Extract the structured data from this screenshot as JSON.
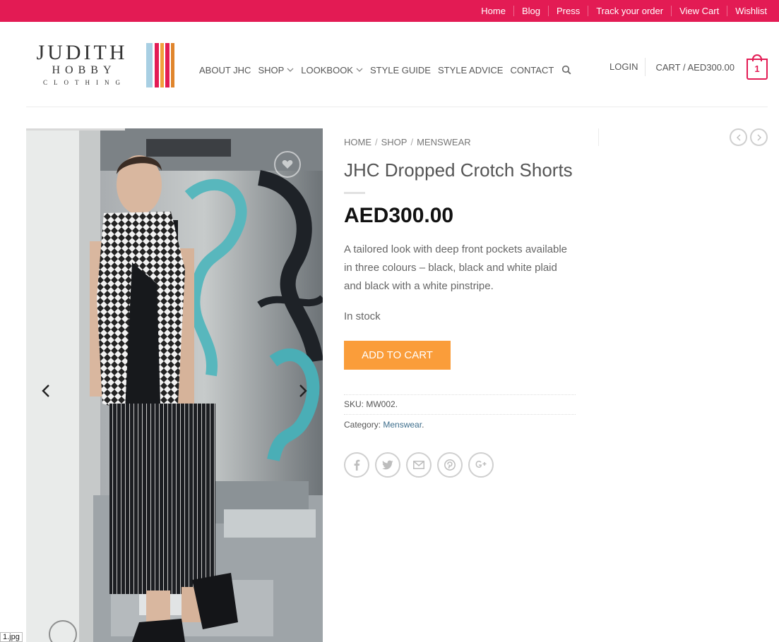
{
  "topbar": {
    "links": [
      "Home",
      "Blog",
      "Press",
      "Track your order",
      "View Cart",
      "Wishlist"
    ]
  },
  "logo": {
    "line1": "JUDITH",
    "line2": "HOBBY",
    "line3": "CLOTHING",
    "stripe_colors": [
      "#a8cfe3",
      "#e31b54",
      "#f2a03c",
      "#e0852c",
      "#e31b54"
    ]
  },
  "nav": {
    "items": [
      {
        "label": "ABOUT JHC",
        "has_caret": false
      },
      {
        "label": "SHOP",
        "has_caret": true
      },
      {
        "label": "LOOKBOOK",
        "has_caret": true
      },
      {
        "label": "STYLE GUIDE",
        "has_caret": false
      },
      {
        "label": "STYLE ADVICE",
        "has_caret": false
      },
      {
        "label": "CONTACT",
        "has_caret": false
      }
    ],
    "search_icon": "search-icon"
  },
  "account": {
    "login": "LOGIN",
    "cart_label": "CART / AED300.00",
    "cart_count": "1"
  },
  "breadcrumb": [
    "HOME",
    "SHOP",
    "MENSWEAR"
  ],
  "product": {
    "title": "JHC Dropped Crotch Shorts",
    "price": "AED300.00",
    "description": "A tailored look with deep front pockets available in three colours – black, black and white plaid and black with a white pinstripe.",
    "stock": "In stock",
    "add_to_cart": "ADD TO CART",
    "sku_label": "SKU:",
    "sku": "MW002.",
    "category_label": "Category:",
    "category": "Menswear",
    "category_suffix": "."
  },
  "share_icons": [
    "facebook-icon",
    "twitter-icon",
    "email-icon",
    "pinterest-icon",
    "google-plus-icon"
  ],
  "image_label": "1.jpg",
  "colors": {
    "brand_pink": "#e31b54",
    "cta_orange": "#fa9d3a",
    "link_blue": "#3d6e8c"
  }
}
